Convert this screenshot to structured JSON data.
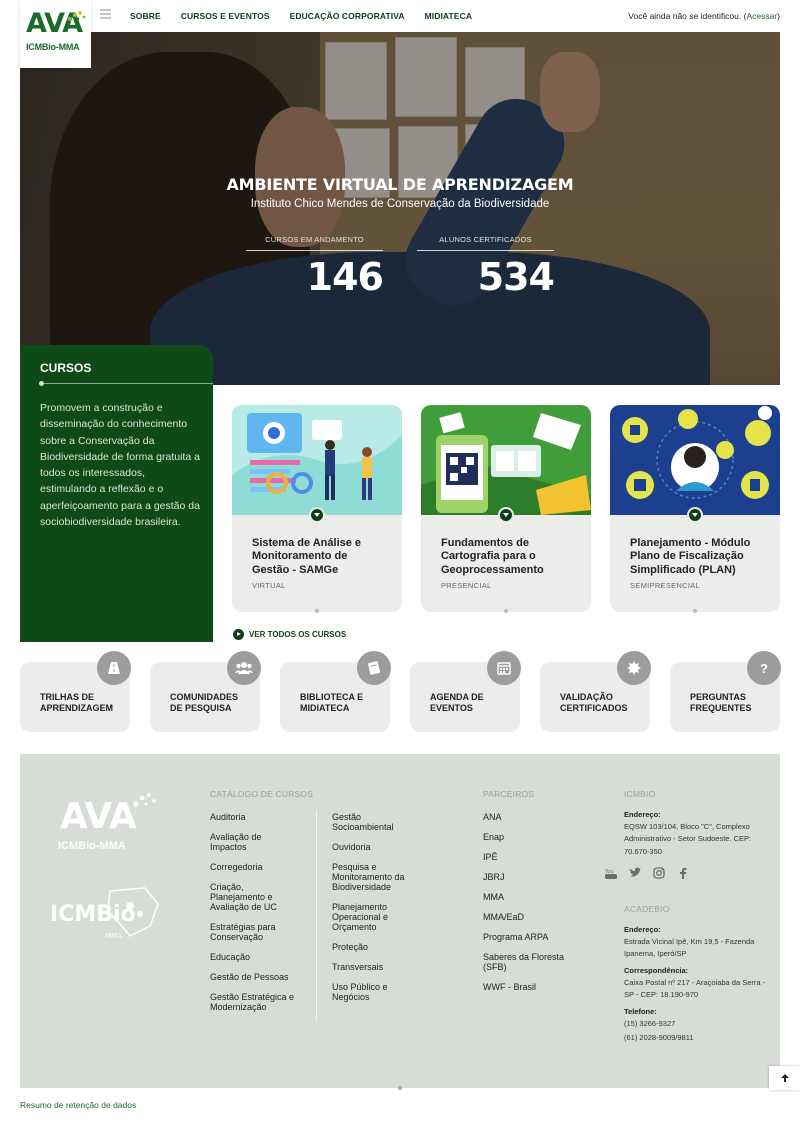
{
  "brand": {
    "logo_text": "AVA",
    "logo_sub": "ICMBio-MMA"
  },
  "nav": {
    "items": [
      "SOBRE",
      "CURSOS E EVENTOS",
      "EDUCAÇÃO CORPORATIVA",
      "MIDIATECA"
    ],
    "login_prefix": "Você ainda não se identificou. (",
    "login_link": "Acessar",
    "login_suffix": ")"
  },
  "hero": {
    "title": "AMBIENTE VIRTUAL DE APRENDIZAGEM",
    "subtitle": "Instituto Chico Mendes de Conservação da Biodiversidade",
    "stats": [
      {
        "label": "CURSOS EM ANDAMENTO",
        "value": "146"
      },
      {
        "label": "ALUNOS CERTIFICADOS",
        "value": "534"
      }
    ]
  },
  "cursos": {
    "title": "CURSOS",
    "description": "Promovem a construção e disseminação do conhecimento sobre a Conservação da Biodiversidade de forma gratuita a todos os interessados, estimulando a reflexão e o aperfeiçoamento para a gestão da sociobiodiversidade brasileira."
  },
  "courses": [
    {
      "title": "Sistema de Análise e Monitoramento de Gestão - SAMGe",
      "mode": "VIRTUAL"
    },
    {
      "title": "Fundamentos de Cartografia para o Geoprocessamento",
      "mode": "PRESENCIAL"
    },
    {
      "title": "Planejamento - Módulo Plano de Fiscalização Simplificado (PLAN)",
      "mode": "SEMIPRESENCIAL"
    }
  ],
  "see_all": "VER TODOS OS CURSOS",
  "quick_links": [
    {
      "line1": "TRILHAS DE",
      "line2": "APRENDIZAGEM",
      "icon": "road-icon"
    },
    {
      "line1": "COMUNIDADES",
      "line2": "DE PESQUISA",
      "icon": "users-icon"
    },
    {
      "line1": "BIBLIOTECA E",
      "line2": "MIDIATECA",
      "icon": "book-icon"
    },
    {
      "line1": "AGENDA DE",
      "line2": "EVENTOS",
      "icon": "calendar-icon"
    },
    {
      "line1": "VALIDAÇÃO",
      "line2": "CERTIFICADOS",
      "icon": "badge-icon"
    },
    {
      "line1": "PERGUNTAS",
      "line2": "FREQUENTES",
      "icon": "question-icon"
    }
  ],
  "footer": {
    "logo_text": "AVA",
    "logo_sub": "ICMBio-MMA",
    "catalog_title": "CATÁLOGO DE CURSOS",
    "catalog_col1": [
      "Auditoria",
      "Avaliação de Impactos",
      "Corregedoria",
      "Criação, Planejamento e Avaliação de UC",
      "Estratégias para Conservação",
      "Educação",
      "Gestão de Pessoas",
      "Gestão Estratégica e Modernização"
    ],
    "catalog_col2": [
      "Gestão Socioambiental",
      "Ouvidoria",
      "Pesquisa e Monitoramento da Biodiversidade",
      "Planejamento Operacional e Orçamento",
      "Proteção",
      "Transversais",
      "Uso Público e Negócios"
    ],
    "partners_title": "PARCEIROS",
    "partners": [
      "ANA",
      "Enap",
      "IPÊ",
      "JBRJ",
      "MMA",
      "MMA/EaD",
      "Programa ARPA",
      "Saberes da Floresta (SFB)",
      "WWF - Brasil"
    ],
    "icmbio_title": "ICMBIO",
    "icmbio_address_label": "Endereço:",
    "icmbio_address": "EQSW 103/104, Bloco \"C\", Complexo Administrativo - Setor Sudoeste. CEP: 70.670-350",
    "acadebio_title": "ACADEBIO",
    "acadebio_address_label": "Endereço:",
    "acadebio_address": "Estrada Vicinal Ipê, Km 19,5 - Fazenda Ipanema, Iperó/SP",
    "acadebio_mail_label": "Correspondência:",
    "acadebio_mail": "Caixa Postal nº 217 - Araçoiaba da Serra - SP - CEP: 18.190-970",
    "acadebio_phone_label": "Telefone:",
    "acadebio_phone1": "(15) 3266-9327",
    "acadebio_phone2": "(61) 2028-9009/9811",
    "social": [
      "youtube-icon",
      "twitter-icon",
      "instagram-icon",
      "facebook-icon"
    ]
  },
  "retention_link": "Resumo de retenção de dados",
  "colors": {
    "primary": "#0e4a16",
    "dark_text": "#0e3d17",
    "link": "#1a6b2a",
    "footer_bg": "#d8dcd7",
    "card_bg": "#ecedea"
  }
}
